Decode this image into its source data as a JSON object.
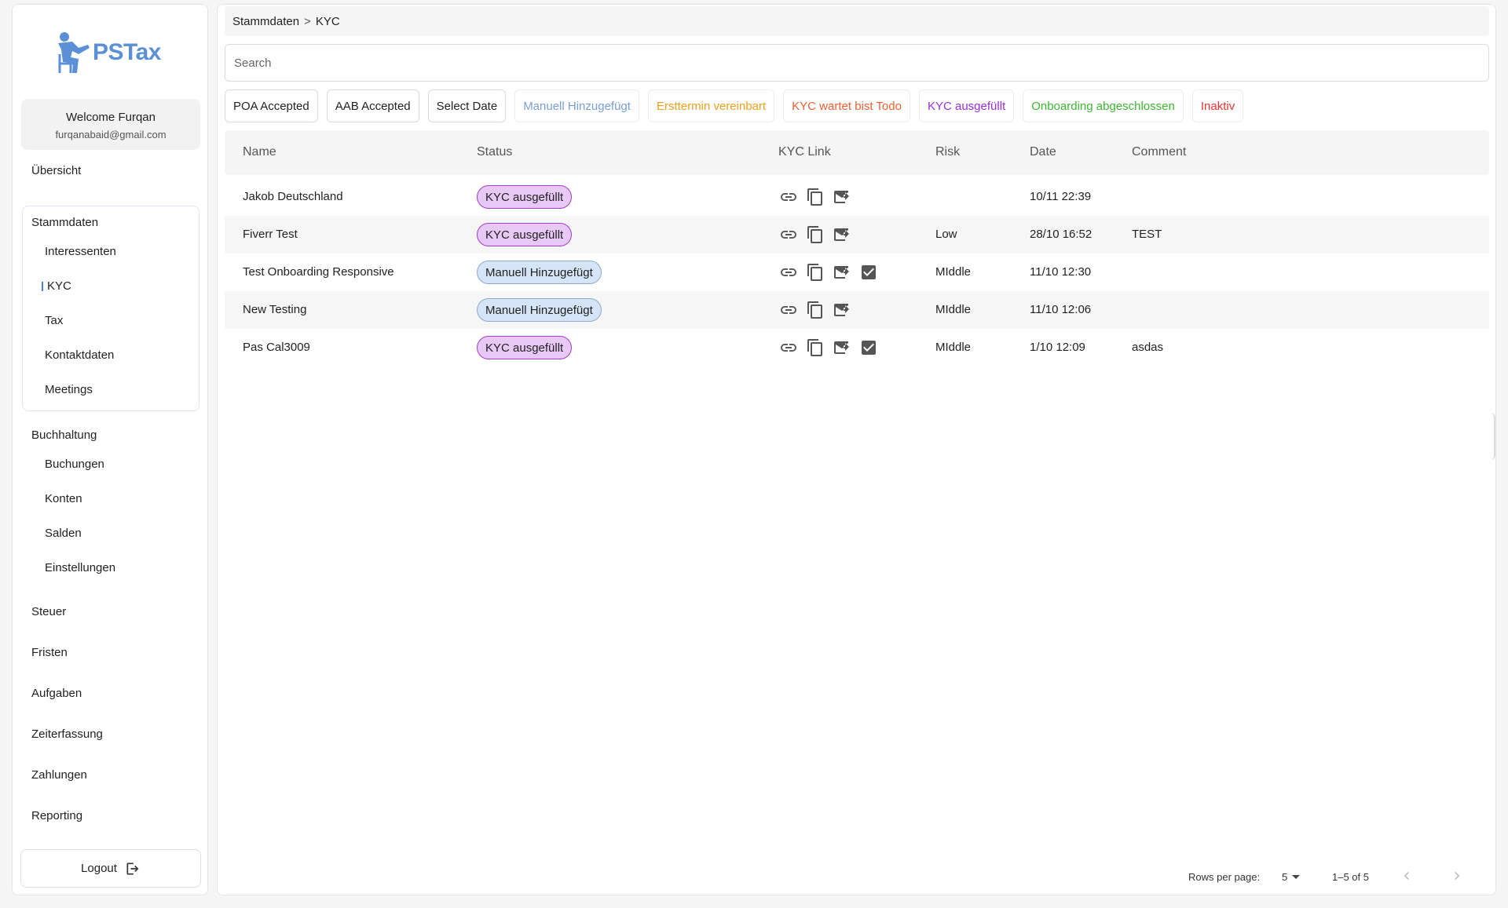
{
  "app": {
    "logo_text": "PSTax"
  },
  "user": {
    "welcome": "Welcome Furqan",
    "email": "furqanabaid@gmail.com"
  },
  "nav": {
    "overview": "Übersicht",
    "stammdaten": {
      "title": "Stammdaten",
      "items": [
        "Interessenten",
        "KYC",
        "Tax",
        "Kontaktdaten",
        "Meetings"
      ]
    },
    "buchhaltung": {
      "title": "Buchhaltung",
      "items": [
        "Buchungen",
        "Konten",
        "Salden",
        "Einstellungen"
      ]
    },
    "others": [
      "Steuer",
      "Fristen",
      "Aufgaben",
      "Zeiterfassung",
      "Zahlungen",
      "Reporting"
    ],
    "logout": "Logout"
  },
  "breadcrumb": {
    "parent": "Stammdaten",
    "separator": ">",
    "current": "KYC"
  },
  "search": {
    "placeholder": "Search",
    "value": ""
  },
  "filters": [
    {
      "label": "POA Accepted",
      "color": "#222222"
    },
    {
      "label": "AAB Accepted",
      "color": "#222222"
    },
    {
      "label": "Select Date",
      "color": "#222222"
    },
    {
      "label": "Manuell Hinzugefügt",
      "color": "#7a9fd6"
    },
    {
      "label": "Ersttermin vereinbart",
      "color": "#f0a020"
    },
    {
      "label": "KYC wartet bist Todo",
      "color": "#f06030"
    },
    {
      "label": "KYC ausgefüllt",
      "color": "#9b30d9"
    },
    {
      "label": "Onboarding abgeschlossen",
      "color": "#3cb830"
    },
    {
      "label": "Inaktiv",
      "color": "#ee3333"
    }
  ],
  "table": {
    "headers": {
      "name": "Name",
      "status": "Status",
      "kyc_link": "KYC Link",
      "risk": "Risk",
      "date": "Date",
      "comment": "Comment"
    },
    "rows": [
      {
        "name": "Jakob Deutschland",
        "status": "KYC ausgefüllt",
        "risk": "",
        "date": "10/11 22:39",
        "comment": ""
      },
      {
        "name": "Fiverr Test",
        "status": "KYC ausgefüllt",
        "risk": "Low",
        "date": "28/10 16:52",
        "comment": "TEST"
      },
      {
        "name": "Test Onboarding Responsive",
        "status": "Manuell Hinzugefügt",
        "risk": "MIddle",
        "date": "11/10 12:30",
        "comment": ""
      },
      {
        "name": "New Testing",
        "status": "Manuell Hinzugefügt",
        "risk": "MIddle",
        "date": "11/10 12:06",
        "comment": ""
      },
      {
        "name": "Pas Cal3009",
        "status": "KYC ausgefüllt",
        "risk": "MIddle",
        "date": "1/10 12:09",
        "comment": "asdas"
      }
    ]
  },
  "pagination": {
    "rows_per_page_label": "Rows per page:",
    "rows_per_page": "5",
    "range": "1–5 of 5"
  }
}
